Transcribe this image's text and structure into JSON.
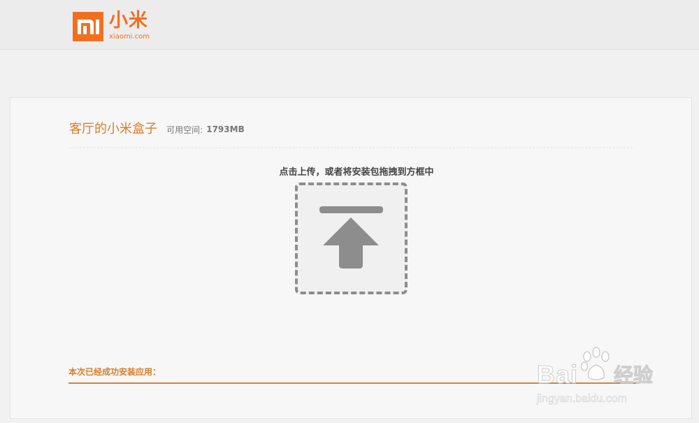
{
  "header": {
    "logo_mark": "MI",
    "logo_cn": "小米",
    "logo_en": "xiaomi.com"
  },
  "panel": {
    "device_name": "客厅的小米盒子",
    "space_label": "可用空间:",
    "space_value": "1793MB",
    "upload_hint": "点击上传，或者将安装包拖拽到方框中",
    "upload_icon": "upload-arrow-icon",
    "installed_label": "本次已经成功安装应用："
  },
  "watermark": {
    "brand": "Bai",
    "brand_suffix": "经验",
    "url": "jingyan.baidu.com"
  },
  "colors": {
    "brand_orange": "#f26f21",
    "accent_orange": "#d87e2a",
    "divider_orange": "#c9863d",
    "upload_gray": "#8d8d8d"
  }
}
